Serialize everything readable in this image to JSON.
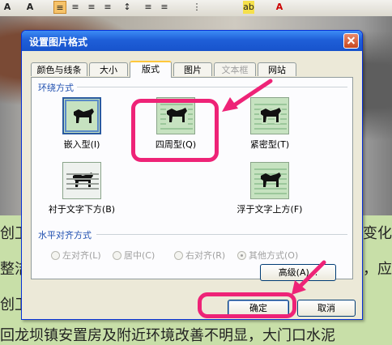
{
  "toolbar": {
    "buttons": [
      "A",
      "A",
      "≡",
      "≡",
      "≡",
      "≡",
      "↕",
      "≡",
      "≡",
      "⋮",
      "ab",
      "A"
    ],
    "accent": "#f6c36a"
  },
  "document": {
    "lines": [
      "创卫",
      "整洁",
      "创卫",
      "回龙坝镇安置房及附近环境改善不明显，大门口水泥"
    ],
    "right_fragments": [
      "经变化",
      "迎，应"
    ],
    "background_color": "#c8dfa8"
  },
  "dialog": {
    "title": "设置图片格式",
    "tabs": [
      {
        "label": "颜色与线条",
        "state": "normal"
      },
      {
        "label": "大小",
        "state": "normal"
      },
      {
        "label": "版式",
        "state": "active"
      },
      {
        "label": "图片",
        "state": "normal"
      },
      {
        "label": "文本框",
        "state": "disabled"
      },
      {
        "label": "网站",
        "state": "normal"
      }
    ],
    "wrap_section_label": "环绕方式",
    "wrap_options": [
      {
        "label": "嵌入型(I)",
        "icon": "inline-icon"
      },
      {
        "label": "四周型(Q)",
        "icon": "square-wrap-icon"
      },
      {
        "label": "紧密型(T)",
        "icon": "tight-wrap-icon"
      },
      {
        "label": "衬于文字下方(B)",
        "icon": "behind-text-icon"
      },
      {
        "label": "浮于文字上方(F)",
        "icon": "in-front-icon"
      }
    ],
    "align_section_label": "水平对齐方式",
    "align_options": [
      {
        "label": "左对齐(L)",
        "checked": false
      },
      {
        "label": "居中(C)",
        "checked": false
      },
      {
        "label": "右对齐(R)",
        "checked": false
      },
      {
        "label": "其他方式(O)",
        "checked": true
      }
    ],
    "advanced_button": "高级(A)...",
    "ok_button": "确定",
    "cancel_button": "取消",
    "title_color": "#1f5fd8",
    "highlight_color": "#ee2377"
  }
}
